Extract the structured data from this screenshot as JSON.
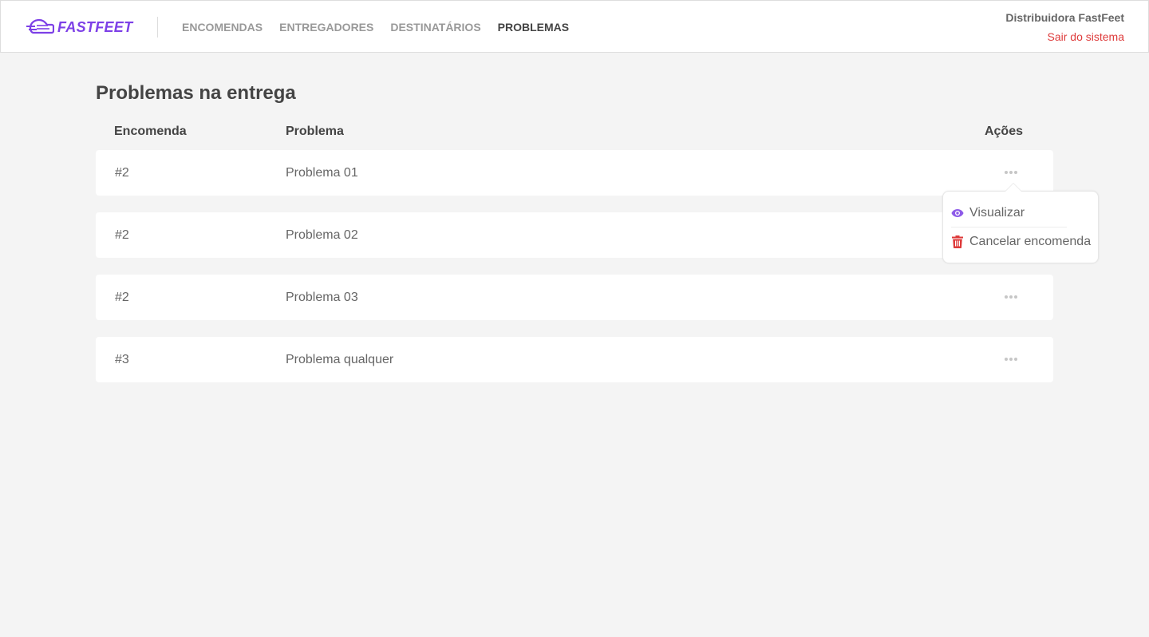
{
  "header": {
    "logo_text": "FASTFEET",
    "nav": [
      {
        "label": "ENCOMENDAS",
        "active": false
      },
      {
        "label": "ENTREGADORES",
        "active": false
      },
      {
        "label": "DESTINATÁRIOS",
        "active": false
      },
      {
        "label": "PROBLEMAS",
        "active": true
      }
    ],
    "user_name": "Distribuidora FastFeet",
    "logout_label": "Sair do sistema"
  },
  "main": {
    "title": "Problemas na entrega",
    "columns": [
      "Encomenda",
      "Problema",
      "Ações"
    ],
    "rows": [
      {
        "order": "#2",
        "problem": "Problema 01"
      },
      {
        "order": "#2",
        "problem": "Problema 02"
      },
      {
        "order": "#2",
        "problem": "Problema 03"
      },
      {
        "order": "#3",
        "problem": "Problema qualquer"
      }
    ]
  },
  "actions_menu": {
    "view_label": "Visualizar",
    "cancel_label": "Cancelar encomenda",
    "view_icon": "eye-icon",
    "cancel_icon": "trash-icon"
  },
  "colors": {
    "brand": "#7d40e7",
    "danger": "#de3b3b",
    "background": "#f4f4f4"
  }
}
